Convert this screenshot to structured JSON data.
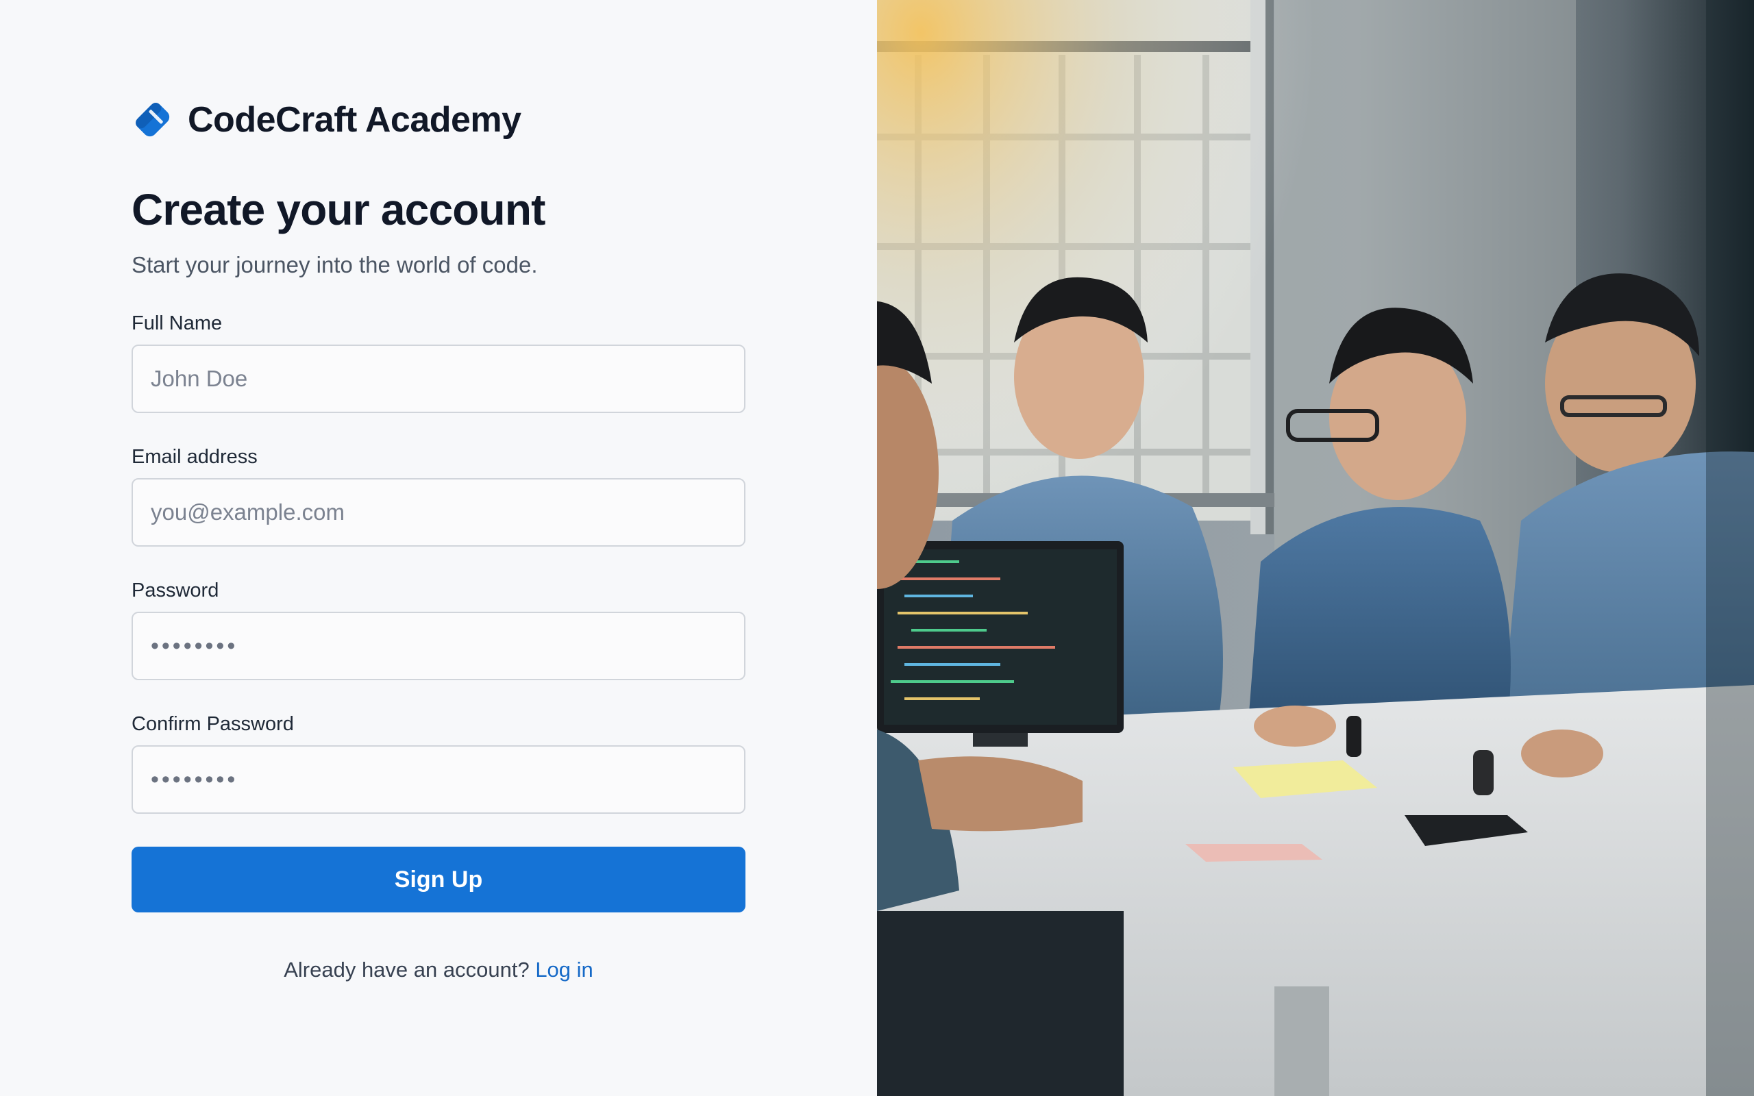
{
  "brand": {
    "name": "CodeCraft Academy",
    "icon": "bookmark-tag-icon",
    "accent": "#1573d6"
  },
  "heading": {
    "title": "Create your account",
    "subtitle": "Start your journey into the world of code."
  },
  "form": {
    "full_name": {
      "label": "Full Name",
      "placeholder": "John Doe"
    },
    "email": {
      "label": "Email address",
      "placeholder": "you@example.com"
    },
    "password": {
      "label": "Password",
      "value": "••••••••"
    },
    "confirm_password": {
      "label": "Confirm Password",
      "value": "••••••••"
    },
    "submit_label": "Sign Up"
  },
  "footer": {
    "prompt": "Already have an account?",
    "login_label": "Log in"
  },
  "hero": {
    "image": "team-coding-photo"
  }
}
